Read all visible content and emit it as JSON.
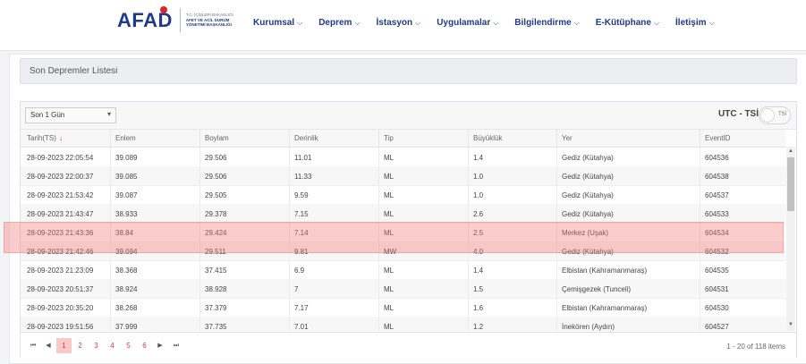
{
  "header": {
    "logo_text": "AFAD",
    "logo_sub": [
      "T.C. İÇİŞLERİ BAKANLIĞI",
      "AFET VE ACİL DURUM",
      "YÖNETİMİ BAŞKANLIĞI"
    ],
    "nav": [
      "Kurumsal",
      "Deprem",
      "İstasyon",
      "Uygulamalar",
      "Bilgilendirme",
      "E-Kütüphane",
      "İletişim"
    ],
    "chevron_icon": "chevron-down-icon"
  },
  "page": {
    "title": "Son Depremler Listesi"
  },
  "filters": {
    "range_value": "Son 1 Gün",
    "timezone_label": "UTC - TSİ",
    "toggle_label": "TSİ"
  },
  "table": {
    "columns": [
      "Tarih(TS)",
      "Enlem",
      "Boylam",
      "Derinlik",
      "Tip",
      "Büyüklük",
      "Yer",
      "EventID"
    ],
    "sort_indicator": "↓",
    "rows": [
      [
        "28-09-2023 22:05:54",
        "39.089",
        "29.506",
        "11.01",
        "ML",
        "1.4",
        "Gediz (Kütahya)",
        "604536"
      ],
      [
        "28-09-2023 22:00:37",
        "39.085",
        "29.506",
        "11.33",
        "ML",
        "1.0",
        "Gediz (Kütahya)",
        "604538"
      ],
      [
        "28-09-2023 21:53:42",
        "39.087",
        "29.505",
        "9.59",
        "ML",
        "1.0",
        "Gediz (Kütahya)",
        "604537"
      ],
      [
        "28-09-2023 21:43:47",
        "38.933",
        "29.378",
        "7.15",
        "ML",
        "2.6",
        "Gediz (Kütahya)",
        "604533"
      ],
      [
        "28-09-2023 21:43:36",
        "38.84",
        "29.424",
        "7.14",
        "ML",
        "2.5",
        "Merkez (Uşak)",
        "604534"
      ],
      [
        "28-09-2023 21:42:46",
        "39.094",
        "29.511",
        "9.81",
        "MW",
        "4.0",
        "Gediz (Kütahya)",
        "604532"
      ],
      [
        "28-09-2023 21:23:09",
        "38.368",
        "37.415",
        "6.9",
        "ML",
        "1.4",
        "Elbistan (Kahramanmaraş)",
        "604535"
      ],
      [
        "28-09-2023 20:51:37",
        "38.924",
        "38.928",
        "7",
        "ML",
        "1.5",
        "Çemişgezek (Tunceli)",
        "604531"
      ],
      [
        "28-09-2023 20:35:20",
        "38.268",
        "37.379",
        "7.17",
        "ML",
        "1.6",
        "Elbistan (Kahramanmaraş)",
        "604530"
      ],
      [
        "28-09-2023 19:51:56",
        "37.999",
        "37.735",
        "7.01",
        "ML",
        "1.2",
        "İnekören (Aydın)",
        "604527"
      ]
    ]
  },
  "pagination": {
    "first": "⏮",
    "prev": "◀",
    "next": "▶",
    "last": "⏭",
    "pages": [
      "1",
      "2",
      "3",
      "4",
      "5",
      "6"
    ],
    "active_page": "1",
    "info": "1 - 20 of 118 items"
  },
  "colors": {
    "brand": "#1f3a8a",
    "accent": "#e53935",
    "highlight": "#f47878"
  }
}
